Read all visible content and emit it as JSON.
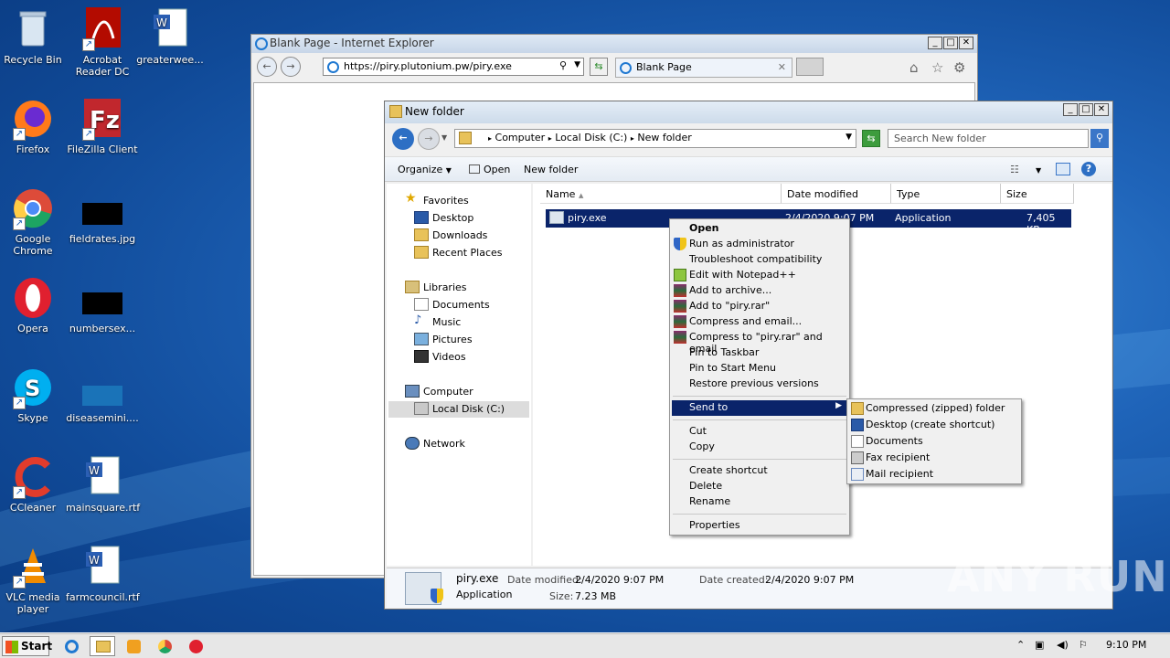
{
  "desktop": {
    "icons": [
      {
        "label": "Recycle Bin"
      },
      {
        "label": "Acrobat Reader DC"
      },
      {
        "label": "greaterwee..."
      },
      {
        "label": "Firefox"
      },
      {
        "label": "FileZilla Client"
      },
      {
        "label": "Google Chrome"
      },
      {
        "label": "fieldrates.jpg"
      },
      {
        "label": "Opera"
      },
      {
        "label": "numbersex..."
      },
      {
        "label": "Skype"
      },
      {
        "label": "diseasemini...."
      },
      {
        "label": "CCleaner"
      },
      {
        "label": "mainsquare.rtf"
      },
      {
        "label": "VLC media player"
      },
      {
        "label": "farmcouncil.rtf"
      }
    ]
  },
  "ie": {
    "title": "Blank Page - Internet Explorer",
    "url": "https://piry.plutonium.pw/piry.exe",
    "tab_label": "Blank Page"
  },
  "explorer": {
    "title": "New folder",
    "breadcrumb": [
      "Computer",
      "Local Disk (C:)",
      "New folder"
    ],
    "search_placeholder": "Search New folder",
    "toolbar": {
      "organize": "Organize",
      "open": "Open",
      "new_folder": "New folder"
    },
    "nav": {
      "favorites": "Favorites",
      "desktop": "Desktop",
      "downloads": "Downloads",
      "recent": "Recent Places",
      "libraries": "Libraries",
      "documents": "Documents",
      "music": "Music",
      "pictures": "Pictures",
      "videos": "Videos",
      "computer": "Computer",
      "local_disk": "Local Disk (C:)",
      "network": "Network"
    },
    "columns": {
      "name": "Name",
      "date": "Date modified",
      "type": "Type",
      "size": "Size"
    },
    "file": {
      "name": "piry.exe",
      "date": "2/4/2020 9:07 PM",
      "type": "Application",
      "size": "7,405 KB"
    },
    "status": {
      "name": "piry.exe",
      "date_modified_label": "Date modified:",
      "date_modified": "2/4/2020 9:07 PM",
      "date_created_label": "Date created:",
      "date_created": "2/4/2020 9:07 PM",
      "type": "Application",
      "size_label": "Size:",
      "size": "7.23 MB"
    }
  },
  "context_menu": {
    "items": [
      "Open",
      "Run as administrator",
      "Troubleshoot compatibility",
      "Edit with Notepad++",
      "Add to archive...",
      "Add to \"piry.rar\"",
      "Compress and email...",
      "Compress to \"piry.rar\" and email",
      "Pin to Taskbar",
      "Pin to Start Menu",
      "Restore previous versions",
      "Send to",
      "Cut",
      "Copy",
      "Create shortcut",
      "Delete",
      "Rename",
      "Properties"
    ]
  },
  "send_to_menu": {
    "items": [
      "Compressed (zipped) folder",
      "Desktop (create shortcut)",
      "Documents",
      "Fax recipient",
      "Mail recipient"
    ]
  },
  "taskbar": {
    "start": "Start",
    "clock": "9:10 PM"
  },
  "watermark": "ANY RUN",
  "colors": {
    "selection": "#0a246a",
    "desktop": "#1f64b9"
  }
}
